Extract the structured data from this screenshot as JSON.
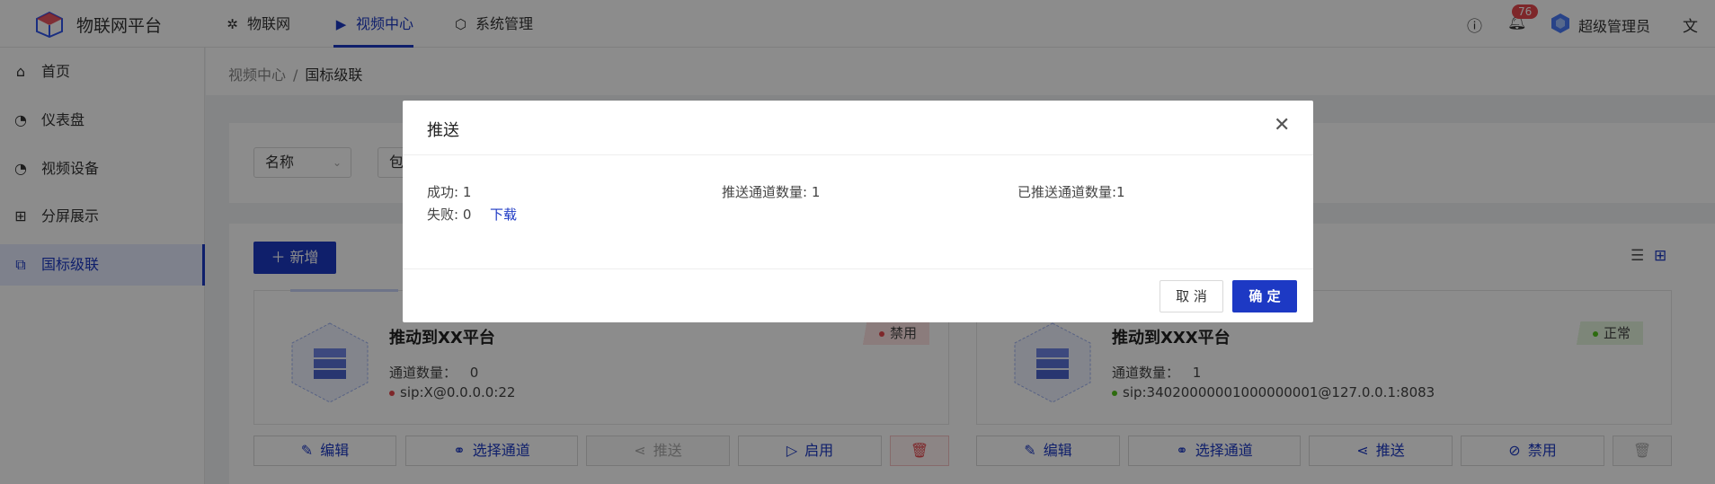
{
  "header": {
    "brand": "物联网平台",
    "nav": [
      {
        "label": "物联网",
        "icon": "iot-icon"
      },
      {
        "label": "视频中心",
        "icon": "play-icon",
        "active": true
      },
      {
        "label": "系统管理",
        "icon": "cube-icon"
      }
    ],
    "notification_count": "76",
    "user_name": "超级管理员",
    "accent_color": "#1d39c4"
  },
  "sidebar": {
    "items": [
      {
        "label": "首页",
        "icon": "home-icon"
      },
      {
        "label": "仪表盘",
        "icon": "dashboard-icon"
      },
      {
        "label": "视频设备",
        "icon": "camera-icon"
      },
      {
        "label": "分屏展示",
        "icon": "grid-icon"
      },
      {
        "label": "国标级联",
        "icon": "cascade-icon",
        "active": true
      }
    ]
  },
  "breadcrumb": {
    "parent": "视频中心",
    "separator": "/",
    "current": "国标级联"
  },
  "filter": {
    "field_select": "名称",
    "op_select": "包"
  },
  "list": {
    "add_label": "新增",
    "platforms": [
      {
        "name": "推动到XX平台",
        "count_label": "通道数量：",
        "count": "0",
        "sip": "sip:X@0.0.0.0:22",
        "status": "禁用",
        "status_color": "#e5484d",
        "actions": [
          "编辑",
          "选择通道",
          "推送",
          "启用"
        ]
      },
      {
        "name": "推动到XXX平台",
        "count_label": "通道数量：",
        "count": "1",
        "sip": "sip:34020000001000000001@127.0.0.1:8083",
        "status": "正常",
        "status_color": "#52c41a",
        "actions": [
          "编辑",
          "选择通道",
          "推送",
          "禁用"
        ]
      }
    ]
  },
  "modal": {
    "title": "推送",
    "success": "成功: 1",
    "fail": "失败: 0",
    "download": "下载",
    "pushed_channel_count": "推送通道数量: 1",
    "already_pushed_count": "已推送通道数量:1",
    "cancel_label": "取 消",
    "ok_label": "确 定"
  }
}
